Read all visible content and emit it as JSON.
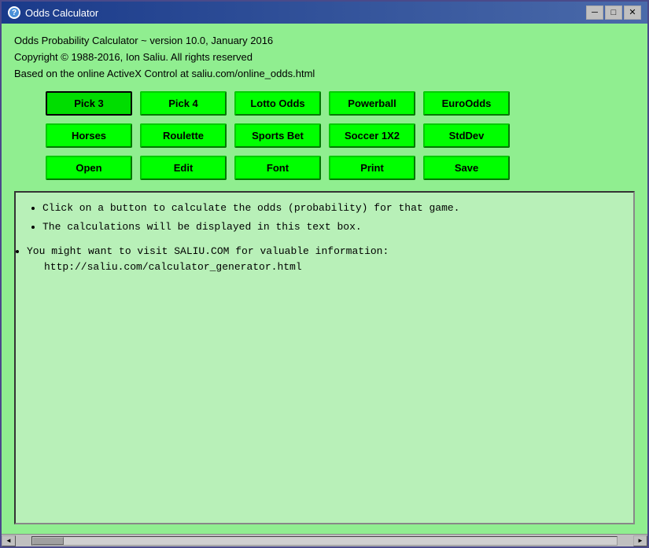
{
  "window": {
    "title": "Odds Calculator",
    "icon_label": "?",
    "close_btn": "✕",
    "minimize_btn": "─",
    "maximize_btn": "□"
  },
  "header": {
    "line1": "Odds Probability Calculator ~ version 10.0, January 2016",
    "line2": "Copyright © 1988-2016, Ion Saliu. All rights reserved",
    "line3": "Based on the online ActiveX Control at saliu.com/online_odds.html"
  },
  "buttons": {
    "row1": [
      {
        "label": "Pick 3",
        "name": "pick3-button",
        "active": true
      },
      {
        "label": "Pick 4",
        "name": "pick4-button"
      },
      {
        "label": "Lotto Odds",
        "name": "lotto-odds-button"
      },
      {
        "label": "Powerball",
        "name": "powerball-button"
      },
      {
        "label": "EuroOdds",
        "name": "euroodds-button"
      }
    ],
    "row2": [
      {
        "label": "Horses",
        "name": "horses-button"
      },
      {
        "label": "Roulette",
        "name": "roulette-button"
      },
      {
        "label": "Sports Bet",
        "name": "sports-bet-button"
      },
      {
        "label": "Soccer 1X2",
        "name": "soccer-button"
      },
      {
        "label": "StdDev",
        "name": "stddev-button"
      }
    ],
    "row3": [
      {
        "label": "Open",
        "name": "open-button"
      },
      {
        "label": "Edit",
        "name": "edit-button"
      },
      {
        "label": "Font",
        "name": "font-button"
      },
      {
        "label": "Print",
        "name": "print-button"
      },
      {
        "label": "Save",
        "name": "save-button"
      }
    ]
  },
  "text_area": {
    "bullet1": "Click on a button to calculate the odds (probability) for that game.",
    "bullet2": "The calculations will be displayed in this text box.",
    "bullet3": "You might want to visit SALIU.COM for valuable information:",
    "url": "http://saliu.com/calculator_generator.html"
  }
}
